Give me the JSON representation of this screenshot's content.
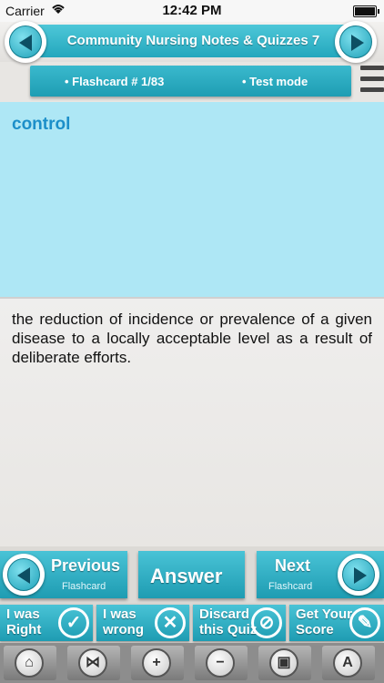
{
  "status_bar": {
    "carrier": "Carrier",
    "time": "12:42 PM"
  },
  "header": {
    "title": "Community Nursing  Notes & Quizzes 7"
  },
  "info_bar": {
    "flashcard": "• Flashcard #  1/83",
    "mode": "• Test mode"
  },
  "card": {
    "question": "control",
    "answer": "the reduction of incidence or prevalence of a given disease to a locally acceptable level as a result of deliberate efforts."
  },
  "nav": {
    "previous": "Previous",
    "previous_sub": "Flashcard",
    "answer": "Answer",
    "next": "Next",
    "next_sub": "Flashcard"
  },
  "actions": {
    "right": [
      "I was",
      "Right"
    ],
    "wrong": [
      "I was",
      "wrong"
    ],
    "discard": [
      "Discard",
      "this Quiz"
    ],
    "score": [
      "Get Your",
      "Score"
    ]
  },
  "toolbar": [
    "home-icon",
    "share-icon",
    "zoom-in-icon",
    "zoom-out-icon",
    "image-icon",
    "font-icon"
  ],
  "colors": {
    "accent": "#23a7bd",
    "question_bg": "#aee7f5",
    "question_text": "#1c8fc9"
  }
}
